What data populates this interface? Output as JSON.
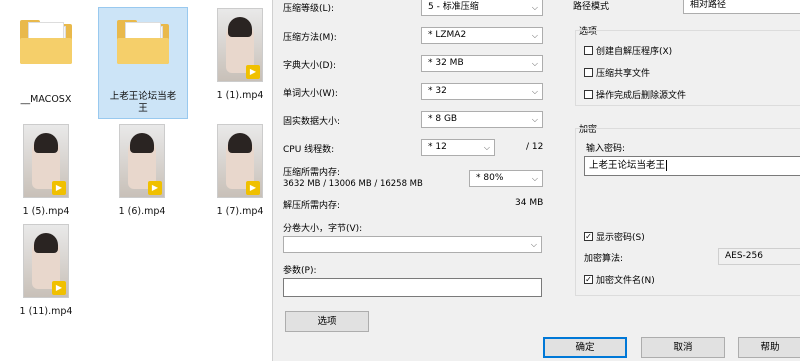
{
  "explorer": {
    "items": [
      {
        "label": "__MACOSX",
        "kind": "folder"
      },
      {
        "label": "上老王论坛当老王",
        "kind": "folder"
      },
      {
        "label": "1 (1).mp4",
        "kind": "video"
      },
      {
        "label": "1 (5).mp4",
        "kind": "video"
      },
      {
        "label": "1 (6).mp4",
        "kind": "video"
      },
      {
        "label": "1 (7).mp4",
        "kind": "video"
      },
      {
        "label": "1 (11).mp4",
        "kind": "video"
      }
    ],
    "badge_text": "▶"
  },
  "dialog": {
    "compression_level": {
      "label": "压缩等级(L):",
      "value": "5 - 标准压缩"
    },
    "compression_method": {
      "label": "压缩方法(M):",
      "value": "* LZMA2"
    },
    "dictionary_size": {
      "label": "字典大小(D):",
      "value": "* 32 MB"
    },
    "word_size": {
      "label": "单词大小(W):",
      "value": "* 32"
    },
    "solid_block_size": {
      "label": "固实数据大小:",
      "value": "* 8 GB"
    },
    "cpu_threads": {
      "label": "CPU 线程数:",
      "value": "* 12",
      "max": "/ 12"
    },
    "memory_compress": {
      "label": "压缩所需内存:",
      "detail": "3632 MB / 13006 MB / 16258 MB",
      "value": "* 80%"
    },
    "memory_decompress": {
      "label": "解压所需内存:",
      "value": "34 MB"
    },
    "split_volumes": {
      "label": "分卷大小，字节(V):",
      "value": ""
    },
    "parameters": {
      "label": "参数(P):",
      "value": ""
    },
    "options_button": "选项",
    "path_mode": {
      "label": "路径模式",
      "value": "相对路径"
    },
    "options_group": {
      "title": "选项",
      "items": [
        {
          "label": "创建自解压程序(X)",
          "checked": false
        },
        {
          "label": "压缩共享文件",
          "checked": false
        },
        {
          "label": "操作完成后删除源文件",
          "checked": false
        }
      ]
    },
    "encryption_group": {
      "title": "加密",
      "password_label": "输入密码:",
      "password_value": "上老王论坛当老王",
      "show_password": {
        "label": "显示密码(S)",
        "checked": true
      },
      "method_label": "加密算法:",
      "method_value": "AES-256",
      "encrypt_names": {
        "label": "加密文件名(N)",
        "checked": true
      }
    },
    "buttons": {
      "ok": "确定",
      "cancel": "取消",
      "help": "帮助"
    }
  }
}
